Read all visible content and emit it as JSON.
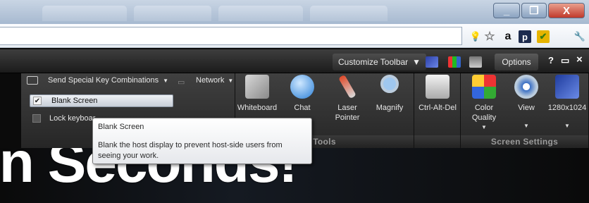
{
  "titlebar": {
    "minimize_glyph": "_",
    "maximize_glyph": "❐",
    "close_glyph": "X"
  },
  "address_bar": {
    "extensions": [
      {
        "name": "bulb-icon",
        "glyph": "💡"
      },
      {
        "name": "star-icon",
        "glyph": "☆"
      },
      {
        "name": "amazon-icon",
        "glyph": "a"
      },
      {
        "name": "p-icon",
        "glyph": "p"
      },
      {
        "name": "check-icon",
        "glyph": "✔"
      },
      {
        "name": "wrench-icon",
        "glyph": "🔧"
      }
    ]
  },
  "toolbar": {
    "customize_label": "Customize Toolbar",
    "options_label": "Options",
    "help_glyph": "?",
    "restore_glyph": "▭",
    "close_glyph": "×"
  },
  "left_menu": {
    "special_keys_label": "Send Special Key Combinations",
    "network_label": "Network",
    "blank_screen_label": "Blank Screen",
    "blank_screen_checked": true,
    "lock_keyboard_label": "Lock keyboar"
  },
  "tools_panel": {
    "label": "Tools",
    "items": [
      {
        "label": "Whiteboard"
      },
      {
        "label": "Chat"
      },
      {
        "label": "Laser Pointer"
      },
      {
        "label": "Magnify"
      }
    ]
  },
  "ctrl_alt_del": {
    "label": "Ctrl-Alt-Del"
  },
  "screen_settings": {
    "label": "Screen Settings",
    "color_quality_label": "Color Quality",
    "view_label": "View",
    "resolution_label": "1280x1024"
  },
  "tooltip": {
    "title": "Blank Screen",
    "body": "Blank the host display to prevent host-side users from seeing your work."
  },
  "hero": {
    "text": "in Seconds!"
  },
  "colors": {
    "toolbar_bg": "#2a2a2a",
    "tooltip_bg": "#f2f3f5",
    "titlebar": "#b3c3d8",
    "close_red": "#c0392b"
  }
}
